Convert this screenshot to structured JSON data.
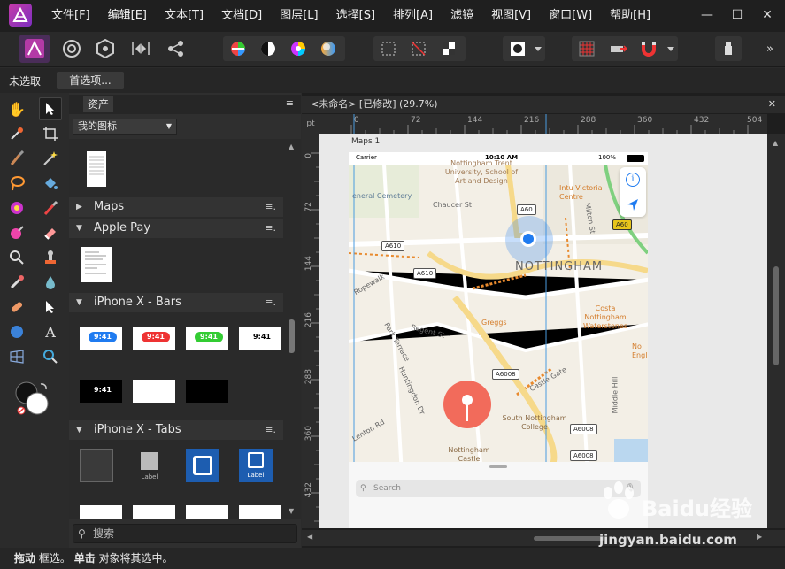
{
  "menu": [
    "文件[F]",
    "编辑[E]",
    "文本[T]",
    "文档[D]",
    "图层[L]",
    "选择[S]",
    "排列[A]",
    "滤镜",
    "视图[V]",
    "窗口[W]",
    "帮助[H]"
  ],
  "window_controls": [
    "minimize",
    "maximize",
    "close"
  ],
  "context": {
    "selection": "未选取",
    "prefs_button": "首选项..."
  },
  "assets": {
    "tab": "资产",
    "category_select": "我的图标",
    "search_placeholder": "搜索",
    "categories": [
      "Maps",
      "Apple Pay",
      "iPhone X - Bars",
      "iPhone X - Tabs"
    ],
    "bars_time": "9:41",
    "tab_label": "Label"
  },
  "document": {
    "title": "<未命名> [已修改] (29.7%)",
    "ruler_unit": "pt",
    "ruler_h": [
      "0",
      "72",
      "144",
      "216",
      "288",
      "360",
      "432",
      "504"
    ],
    "ruler_v": [
      "0",
      "72",
      "144",
      "216",
      "288",
      "360",
      "432"
    ],
    "artboard": "Maps 1"
  },
  "phone": {
    "carrier": "Carrier",
    "time": "10:10 AM",
    "battery": "100%",
    "search_placeholder": "Search",
    "city": "NOTTINGHAM",
    "labels": {
      "university": "Nottingham Trent University, School of Art and Design",
      "cemetery": "eneral Cemetery",
      "chaucer": "Chaucer St",
      "intu": "Intu Victoria Centre",
      "milton": "Milton St",
      "ropewalk": "Ropewalk",
      "regent": "Regent St",
      "park_terrace": "Park Terrace",
      "greggs": "Greggs",
      "costa": "Costa Nottingham Waterstones",
      "castle_gate": "Castle Gate",
      "huntingdon": "Huntingdon Dr",
      "lenton": "Lenton Rd",
      "college": "South Nottingham College",
      "castle": "Nottingham Castle",
      "middle_hill": "Middle Hill",
      "engl": "No Engl"
    },
    "shields": [
      "A60",
      "A610",
      "A610",
      "A6008",
      "A6008",
      "A6008",
      "A60"
    ]
  },
  "status": {
    "bold1": "拖动",
    "text1": "框选。",
    "bold2": "单击",
    "text2": "对象将其选中。"
  },
  "watermark": {
    "brand": "Baidu经验",
    "url": "jingyan.baidu.com"
  },
  "colors": {
    "accent": "#4a9be0",
    "pin": "#f26b5b",
    "location_dot": "#1f7bf0"
  }
}
